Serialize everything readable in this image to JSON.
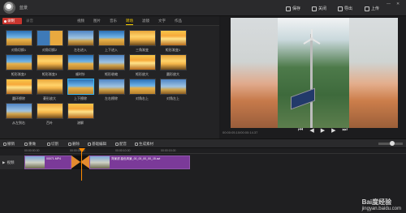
{
  "titlebar": {
    "project_name": "蓝景",
    "save_label": "保存",
    "close_label": "关闭",
    "export_label": "导出",
    "upload_label": "上传"
  },
  "menubar": {
    "record_label": "录制",
    "minor_label": "录音",
    "tabs": [
      {
        "label": "视频",
        "active": false
      },
      {
        "label": "图片",
        "active": false
      },
      {
        "label": "音乐",
        "active": false
      },
      {
        "label": "转场",
        "active": true
      },
      {
        "label": "滤镜",
        "active": false
      },
      {
        "label": "文字",
        "active": false
      },
      {
        "label": "作品",
        "active": false
      }
    ]
  },
  "transitions": [
    "对角切换1",
    "对角切换2",
    "左右进入",
    "上下进入",
    "三角渐变",
    "矩形渐变1",
    "矩形渐变2",
    "矩形渐变3",
    "顺时针",
    "矩形收缩",
    "矩形放大",
    "圆形放大",
    "圆环擦除",
    "菱形放大",
    "上下擦除",
    "左右擦除",
    "对角右上",
    "对角左上",
    "从左到右",
    "百叶",
    "溶解"
  ],
  "preview": {
    "time": "00:00:05.10/00:00:14.37"
  },
  "toolbar": {
    "tools": [
      "撤销",
      "重做",
      "切割",
      "删除",
      "基础编辑",
      "配音",
      "生成素材"
    ]
  },
  "timeline": {
    "ruler": [
      "00:00:00.00",
      "00:00:05.00",
      "00:00:10.00",
      "00:00:15.00"
    ],
    "track_label": "视频",
    "clip1": "00071.MP4",
    "clip2": "背景滤-蓝色风景_00_00_00_00_15.avi"
  },
  "colors": {
    "accent": "#ffd400",
    "record": "#c8352e",
    "clip": "#7b3a99",
    "playhead": "#ff8a00",
    "selection": "#39b5f0"
  },
  "watermark": {
    "brand": "Bai度经验",
    "url": "jingyan.baidu.com"
  }
}
